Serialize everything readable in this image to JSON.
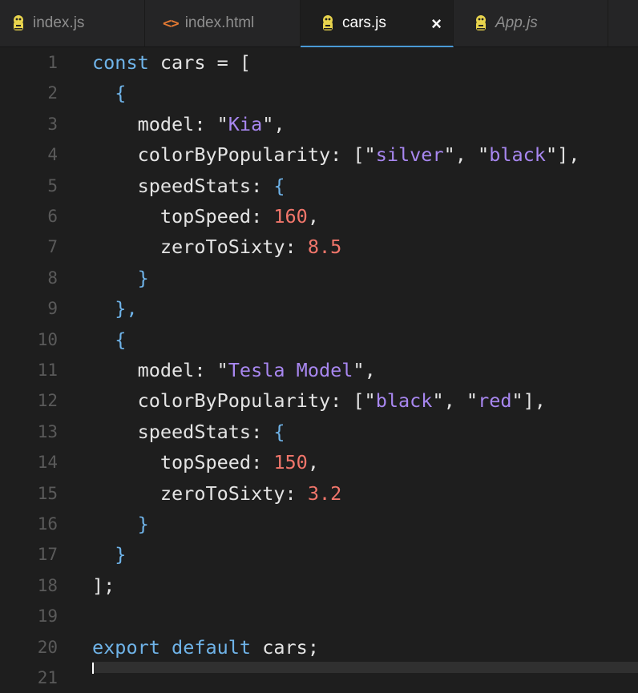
{
  "tabs": [
    {
      "label": "index.js",
      "icon": "js-icon",
      "active": false,
      "italic": false
    },
    {
      "label": "index.html",
      "icon": "html-icon",
      "active": false,
      "italic": false
    },
    {
      "label": "cars.js",
      "icon": "js-icon",
      "active": true,
      "italic": false
    },
    {
      "label": "App.js",
      "icon": "js-icon",
      "active": false,
      "italic": true
    }
  ],
  "close_glyph": "×",
  "html_glyph": "<>",
  "line_numbers": [
    "1",
    "2",
    "3",
    "4",
    "5",
    "6",
    "7",
    "8",
    "9",
    "10",
    "11",
    "12",
    "13",
    "14",
    "15",
    "16",
    "17",
    "18",
    "19",
    "20",
    "21"
  ],
  "code": {
    "l1_kw": "const",
    "l1_rest": " cars = [",
    "l2": "{",
    "l3_key": "model: \"",
    "l3_str": "Kia",
    "l3_end": "\",",
    "l4_key": "colorByPopularity: [\"",
    "l4_s1": "silver",
    "l4_mid": "\", \"",
    "l4_s2": "black",
    "l4_end": "\"],",
    "l5_key": "speedStats: ",
    "l5_brace": "{",
    "l6_key": "topSpeed: ",
    "l6_num": "160",
    "l6_end": ",",
    "l7_key": "zeroToSixty: ",
    "l7_num": "8.5",
    "l8": "}",
    "l9": "},",
    "l10": "{",
    "l11_key": "model: \"",
    "l11_str": "Tesla Model",
    "l11_end": "\",",
    "l12_key": "colorByPopularity: [\"",
    "l12_s1": "black",
    "l12_mid": "\", \"",
    "l12_s2": "red",
    "l12_end": "\"],",
    "l13_key": "speedStats: ",
    "l13_brace": "{",
    "l14_key": "topSpeed: ",
    "l14_num": "150",
    "l14_end": ",",
    "l15_key": "zeroToSixty: ",
    "l15_num": "3.2",
    "l16": "}",
    "l17": "}",
    "l18": "];",
    "l20_kw1": "export",
    "l20_kw2": "default",
    "l20_rest": " cars;"
  },
  "colors": {
    "keyword": "#6fb3e8",
    "string": "#a887f0",
    "number": "#f2766b",
    "tab_active_underline": "#4a9ad6",
    "js_icon": "#e8d44d"
  }
}
